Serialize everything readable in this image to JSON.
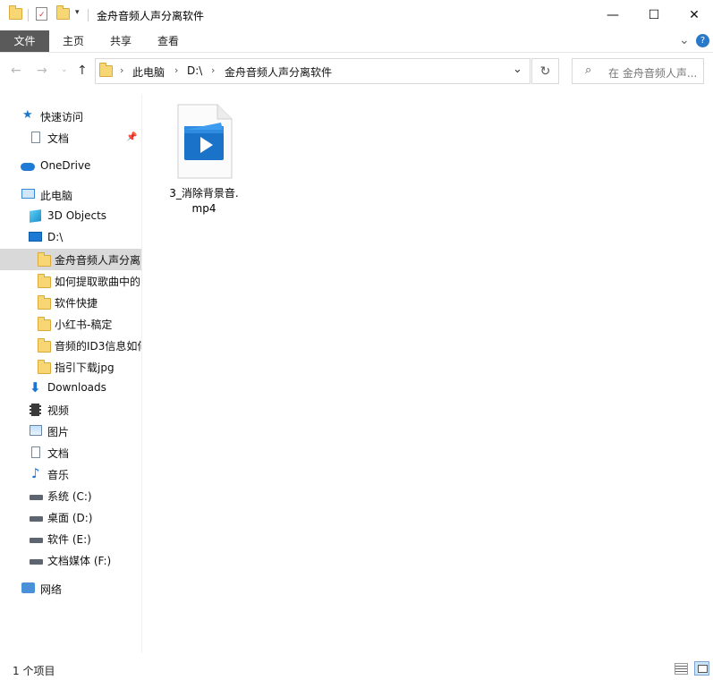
{
  "window": {
    "title": "金舟音频人声分离软件",
    "minimize": "—",
    "maximize": "☐",
    "close": "✕"
  },
  "ribbon": {
    "tabs": [
      {
        "label": "文件"
      },
      {
        "label": "主页"
      },
      {
        "label": "共享"
      },
      {
        "label": "查看"
      }
    ],
    "expand": "⌄",
    "help": "?"
  },
  "address": {
    "crumbs": [
      "此电脑",
      "D:\\",
      "金舟音频人声分离软件"
    ],
    "dropdown": "⌄",
    "refresh": "↻"
  },
  "search": {
    "placeholder": "在 金舟音频人声..."
  },
  "navpane": {
    "items": [
      {
        "label": "快速访问",
        "icon": "star-icon"
      },
      {
        "label": "文档",
        "icon": "document-icon",
        "pinned": true
      },
      {
        "label": "OneDrive",
        "icon": "cloud-icon"
      },
      {
        "label": "此电脑",
        "icon": "computer-icon"
      },
      {
        "label": "3D Objects",
        "icon": "cube-icon"
      },
      {
        "label": "D:\\",
        "icon": "monitor-icon"
      },
      {
        "label": "金舟音频人声分离",
        "icon": "folder-icon",
        "selected": true
      },
      {
        "label": "如何提取歌曲中的",
        "icon": "folder-icon"
      },
      {
        "label": "软件快捷",
        "icon": "folder-icon"
      },
      {
        "label": "小红书-稿定",
        "icon": "folder-icon"
      },
      {
        "label": "音频的ID3信息如何",
        "icon": "folder-icon"
      },
      {
        "label": "指引下载jpg",
        "icon": "folder-icon"
      },
      {
        "label": "Downloads",
        "icon": "download-icon"
      },
      {
        "label": "视频",
        "icon": "film-icon"
      },
      {
        "label": "图片",
        "icon": "picture-icon"
      },
      {
        "label": "文档",
        "icon": "document-icon"
      },
      {
        "label": "音乐",
        "icon": "music-icon"
      },
      {
        "label": "系统 (C:)",
        "icon": "drive-icon"
      },
      {
        "label": "桌面 (D:)",
        "icon": "drive-icon"
      },
      {
        "label": "软件 (E:)",
        "icon": "drive-icon"
      },
      {
        "label": "文档媒体 (F:)",
        "icon": "drive-icon"
      },
      {
        "label": "网络",
        "icon": "network-icon"
      }
    ]
  },
  "files": [
    {
      "name_line1": "3_消除背景音.",
      "name_line2": "mp4",
      "icon": "video-file-icon"
    }
  ],
  "status": {
    "count": "1 个项目"
  },
  "colors": {
    "accent": "#1e76c9",
    "selected_bg": "#d9d9d9",
    "file_tab": "#5a5a5a"
  }
}
